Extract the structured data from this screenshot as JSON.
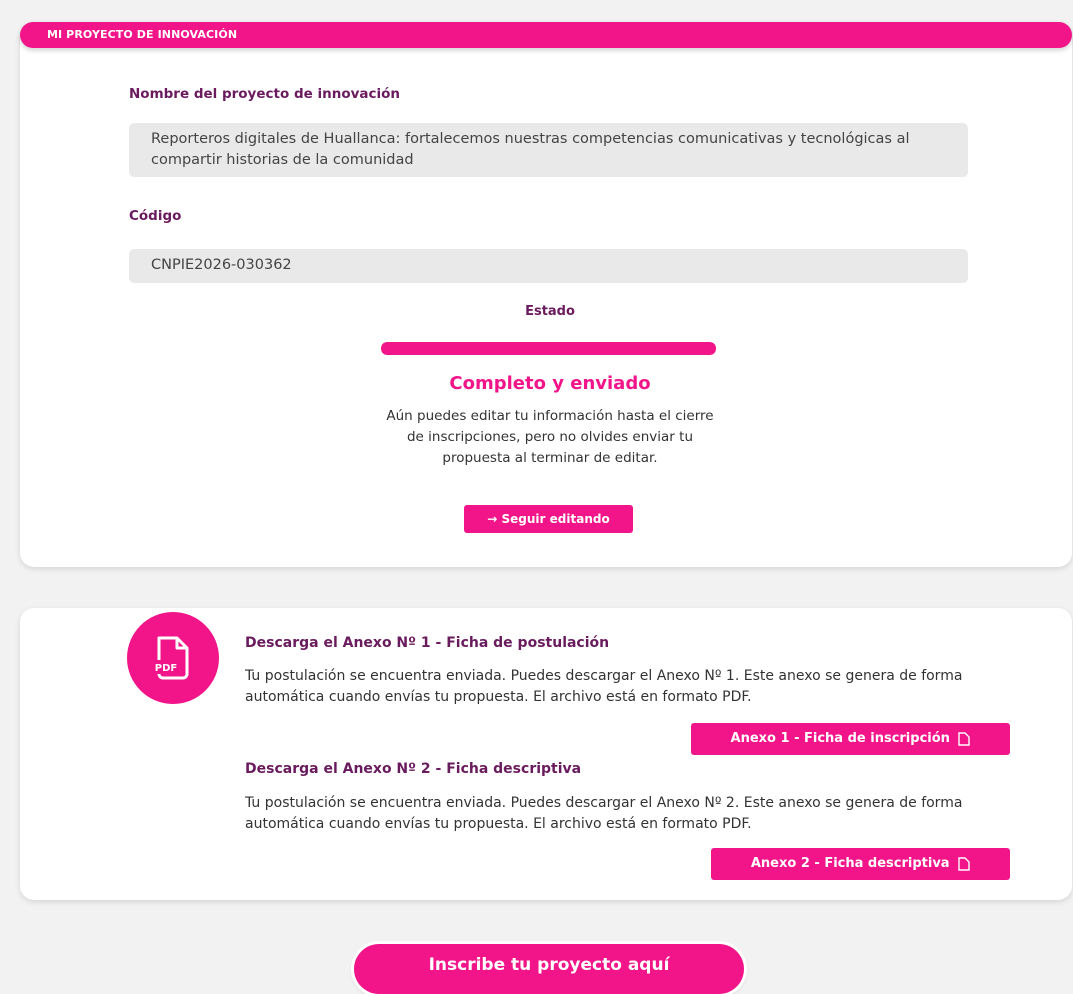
{
  "section": {
    "header": "MI PROYECTO DE INNOVACIÓN"
  },
  "project": {
    "name_label": "Nombre del proyecto de innovación",
    "name_value": "Reporteros digitales de Huallanca: fortalecemos nuestras competencias comunicativas y tecnológicas al compartir historias de la comunidad",
    "code_label": "Código",
    "code_value": "CNPIE2026-030362"
  },
  "status": {
    "label": "Estado",
    "progress": 1.0,
    "title": "Completo y enviado",
    "description": "Aún puedes editar tu información hasta el cierre de inscripciones, pero no olvides enviar tu propuesta al terminar de editar.",
    "edit_button": "→ Seguir editando"
  },
  "downloads": {
    "pdf_icon_label": "PDF",
    "annex1": {
      "title": "Descarga el Anexo Nº 1 - Ficha de postulación",
      "description": "Tu postulación se encuentra enviada. Puedes descargar el Anexo Nº 1. Este anexo se genera de forma automática cuando envías tu propuesta. El archivo está en formato PDF.",
      "button": "Anexo 1 - Ficha de inscripción"
    },
    "annex2": {
      "title": "Descarga el Anexo Nº 2 - Ficha descriptiva",
      "description": "Tu postulación se encuentra enviada. Puedes descargar el Anexo Nº 2. Este anexo se genera de forma automática cuando envías tu propuesta. El archivo está en formato PDF.",
      "button": "Anexo 2 - Ficha descriptiva"
    }
  },
  "footer": {
    "cta_button": "Inscribe tu proyecto aquí"
  },
  "colors": {
    "accent": "#f2158a",
    "label": "#6a1b5e",
    "field_bg": "#e9e9e9",
    "page_bg": "#f2f2f2"
  }
}
